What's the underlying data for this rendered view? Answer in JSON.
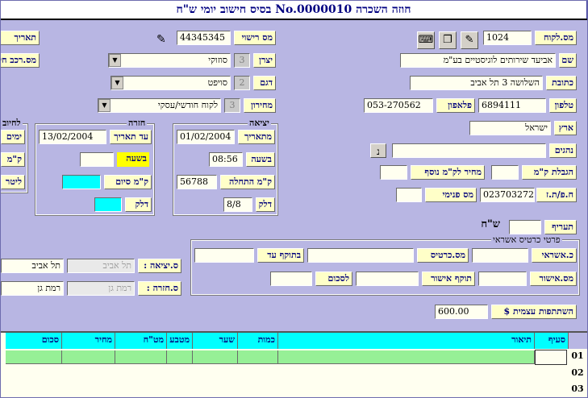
{
  "window": {
    "title": "חוזה השכרה No.0000010 בסיס חישוב יומי ש\"ח"
  },
  "customer": {
    "id_label": "מס.לקוח",
    "id_value": "1024",
    "name_label": "שם",
    "name_value": "אביעד שירותים לוגיסטיים בע\"מ",
    "address_label": "כתובת",
    "address_value": "השלושה 3 תל אביב",
    "phone_label": "טלפון",
    "phone_value": "6894111",
    "mobile_label": "פלאפון",
    "mobile_value": "053-270562",
    "country_label": "ארץ",
    "country_value": "ישראל",
    "drivers_label": "נהגים",
    "drivers_btn": "נ",
    "km_limit_label": "הגבלת ק\"מ",
    "extra_km_label": "מחיר לק\"מ נוסף",
    "company_id_label": "ח.פ/ת.ז",
    "company_id_value": "023703272",
    "internal_no_label": "מס פנימי",
    "tariff_label": "תעריף",
    "currency": "ש\"ח"
  },
  "vehicle": {
    "license_label": "מס רישוי",
    "license_value": "44345345",
    "maker_label": "יצרן",
    "maker_code": "3",
    "maker_value": "סוזוקי",
    "model_label": "דגם",
    "model_code": "2",
    "model_value": "סויפט",
    "pricelist_label": "מחירון",
    "pricelist_code": "3",
    "pricelist_value": "לקוח חודשי/עסקי",
    "date_label": "תאריך",
    "alt_car_label": "מס.רכב חלופי"
  },
  "departure": {
    "title": "יציאה",
    "date_label": "מתאריך",
    "date_value": "01/02/2004",
    "time_label": "בשעה",
    "time_value": "08:56",
    "km_label": "ק\"מ התחלה",
    "km_value": "56788",
    "fuel_label": "דלק",
    "fuel_value": "8/8"
  },
  "return": {
    "title": "חזרה",
    "date_label": "עד תאריך",
    "date_value": "13/02/2004",
    "time_label": "בשעה",
    "km_label": "ק\"מ סיום",
    "fuel_label": "דלק"
  },
  "billing": {
    "title": "לחיוב",
    "days_label": "ימים",
    "km_label": "ק\"מ",
    "liter_label": "ליטר"
  },
  "branches": {
    "out_label": "ס.יציאה :",
    "out_placeholder": "תל אביב",
    "out_value": "תל אביב",
    "in_label": "ס.חזרה :",
    "in_placeholder": "רמת גן",
    "in_value": "רמת גן"
  },
  "credit": {
    "title": "פרטי כרטיס אשראי",
    "card_label": "כ.אשראי",
    "card_no_label": "מס.כרטיס",
    "valid_label": "בתוקף עד",
    "approval_no_label": "מס.אישור",
    "approval_valid_label": "תוקף אישור",
    "amount_label": "לסכום"
  },
  "deductible": {
    "label": "השתתפות עצמית $",
    "value": "600.00"
  },
  "grid": {
    "columns": [
      "סעיף",
      "תיאור",
      "כמות",
      "שער",
      "מטבע",
      "מט\"ח",
      "מחיר",
      "סכום"
    ],
    "rows": [
      "01",
      "02",
      "03"
    ]
  }
}
